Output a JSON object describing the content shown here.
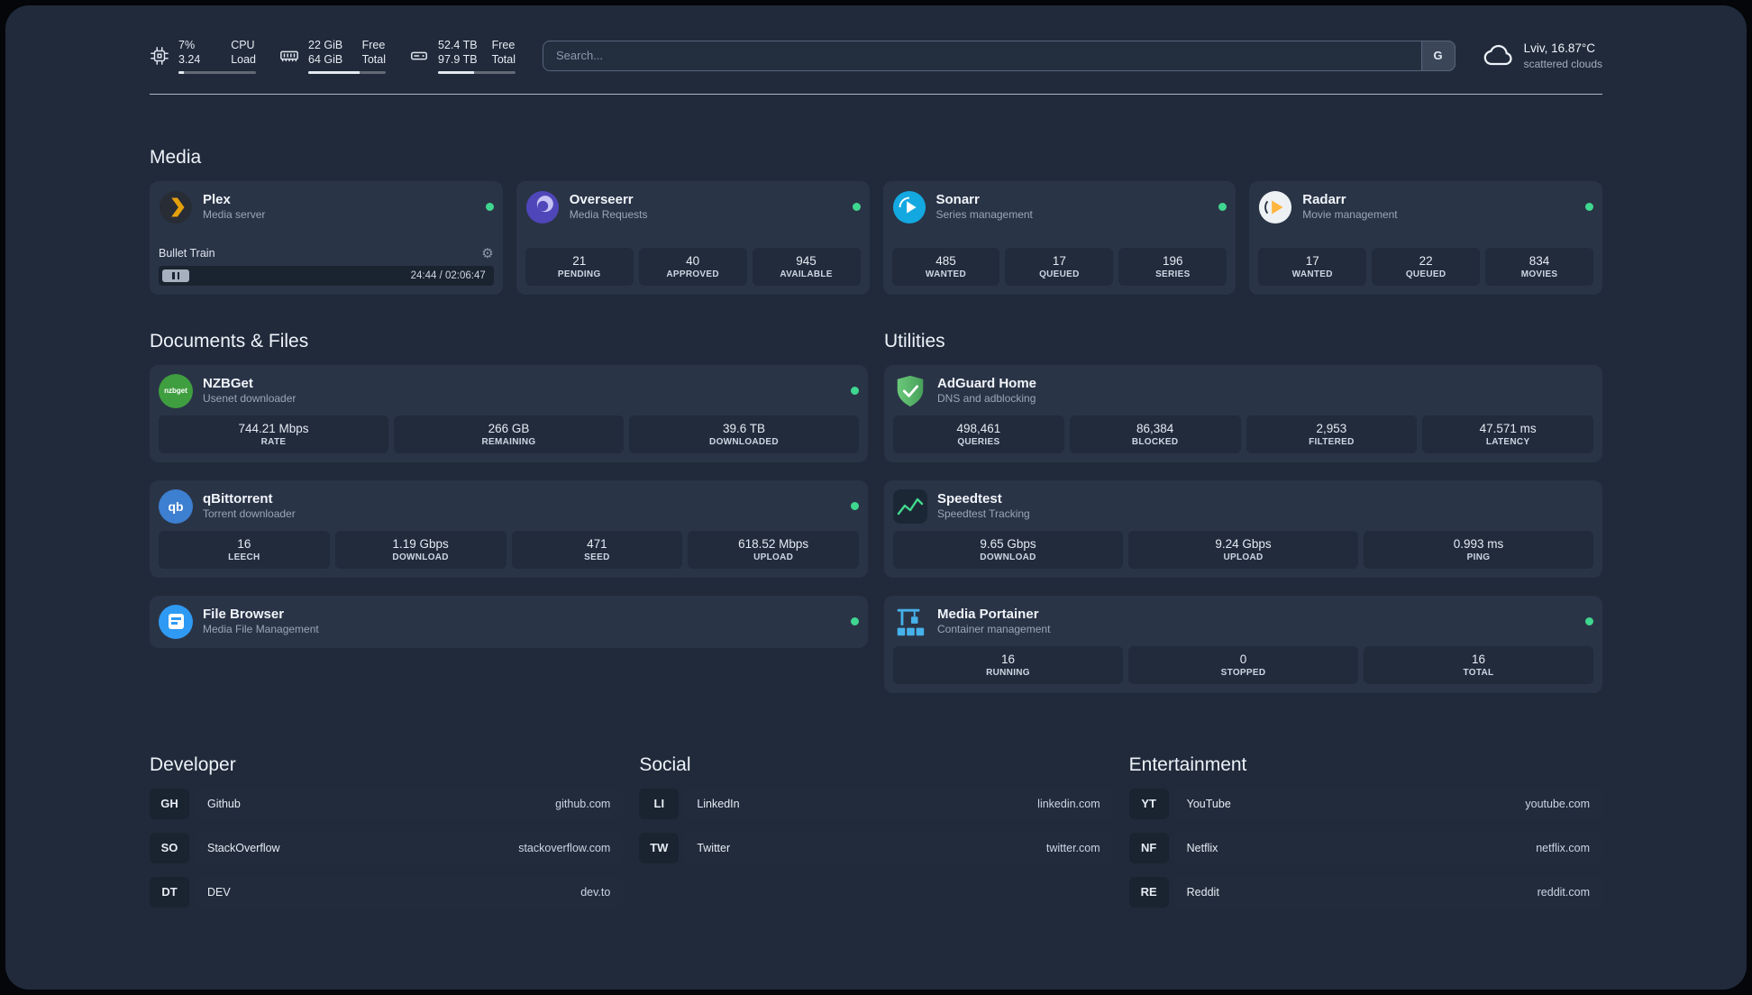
{
  "topbar": {
    "cpu": {
      "value1": "7%",
      "value2": "3.24",
      "label1": "CPU",
      "label2": "Load",
      "fill_percent": 7
    },
    "memory": {
      "value1": "22 GiB",
      "value2": "64 GiB",
      "label1": "Free",
      "label2": "Total",
      "fill_percent": 66
    },
    "disk": {
      "value1": "52.4 TB",
      "value2": "97.9 TB",
      "label1": "Free",
      "label2": "Total",
      "fill_percent": 47
    },
    "search": {
      "placeholder": "Search...",
      "engine_label": "G"
    },
    "weather": {
      "location": "Lviv, 16.87°C",
      "condition": "scattered clouds"
    }
  },
  "sections": {
    "media": {
      "title": "Media",
      "cards": [
        {
          "name": "Plex",
          "subtitle": "Media server",
          "status": "online",
          "player": {
            "track": "Bullet Train",
            "time": "24:44 / 02:06:47"
          }
        },
        {
          "name": "Overseerr",
          "subtitle": "Media Requests",
          "status": "online",
          "stats": [
            {
              "value": "21",
              "label": "PENDING"
            },
            {
              "value": "40",
              "label": "APPROVED"
            },
            {
              "value": "945",
              "label": "AVAILABLE"
            }
          ]
        },
        {
          "name": "Sonarr",
          "subtitle": "Series management",
          "status": "online",
          "stats": [
            {
              "value": "485",
              "label": "WANTED"
            },
            {
              "value": "17",
              "label": "QUEUED"
            },
            {
              "value": "196",
              "label": "SERIES"
            }
          ]
        },
        {
          "name": "Radarr",
          "subtitle": "Movie management",
          "status": "online",
          "stats": [
            {
              "value": "17",
              "label": "WANTED"
            },
            {
              "value": "22",
              "label": "QUEUED"
            },
            {
              "value": "834",
              "label": "MOVIES"
            }
          ]
        }
      ]
    },
    "documents": {
      "title": "Documents & Files",
      "cards": [
        {
          "name": "NZBGet",
          "subtitle": "Usenet downloader",
          "status": "online",
          "icon_text": "nzbget",
          "stats": [
            {
              "value": "744.21 Mbps",
              "label": "RATE"
            },
            {
              "value": "266 GB",
              "label": "REMAINING"
            },
            {
              "value": "39.6 TB",
              "label": "DOWNLOADED"
            }
          ]
        },
        {
          "name": "qBittorrent",
          "subtitle": "Torrent downloader",
          "status": "online",
          "icon_text": "qb",
          "stats": [
            {
              "value": "16",
              "label": "LEECH"
            },
            {
              "value": "1.19 Gbps",
              "label": "DOWNLOAD"
            },
            {
              "value": "471",
              "label": "SEED"
            },
            {
              "value": "618.52 Mbps",
              "label": "UPLOAD"
            }
          ]
        },
        {
          "name": "File Browser",
          "subtitle": "Media File Management",
          "status": "online"
        }
      ]
    },
    "utilities": {
      "title": "Utilities",
      "cards": [
        {
          "name": "AdGuard Home",
          "subtitle": "DNS and adblocking",
          "stats": [
            {
              "value": "498,461",
              "label": "QUERIES"
            },
            {
              "value": "86,384",
              "label": "BLOCKED"
            },
            {
              "value": "2,953",
              "label": "FILTERED"
            },
            {
              "value": "47.571 ms",
              "label": "LATENCY"
            }
          ]
        },
        {
          "name": "Speedtest",
          "subtitle": "Speedtest Tracking",
          "stats": [
            {
              "value": "9.65 Gbps",
              "label": "DOWNLOAD"
            },
            {
              "value": "9.24 Gbps",
              "label": "UPLOAD"
            },
            {
              "value": "0.993 ms",
              "label": "PING"
            }
          ]
        },
        {
          "name": "Media Portainer",
          "subtitle": "Container management",
          "status": "online",
          "stats": [
            {
              "value": "16",
              "label": "RUNNING"
            },
            {
              "value": "0",
              "label": "STOPPED"
            },
            {
              "value": "16",
              "label": "TOTAL"
            }
          ]
        }
      ]
    },
    "bookmarks": [
      {
        "title": "Developer",
        "items": [
          {
            "abbr": "GH",
            "name": "Github",
            "domain": "github.com"
          },
          {
            "abbr": "SO",
            "name": "StackOverflow",
            "domain": "stackoverflow.com"
          },
          {
            "abbr": "DT",
            "name": "DEV",
            "domain": "dev.to"
          }
        ]
      },
      {
        "title": "Social",
        "items": [
          {
            "abbr": "LI",
            "name": "LinkedIn",
            "domain": "linkedin.com"
          },
          {
            "abbr": "TW",
            "name": "Twitter",
            "domain": "twitter.com"
          }
        ]
      },
      {
        "title": "Entertainment",
        "items": [
          {
            "abbr": "YT",
            "name": "YouTube",
            "domain": "youtube.com"
          },
          {
            "abbr": "NF",
            "name": "Netflix",
            "domain": "netflix.com"
          },
          {
            "abbr": "RE",
            "name": "Reddit",
            "domain": "reddit.com"
          }
        ]
      }
    ]
  },
  "colors": {
    "status_online": "#3fd68f",
    "plex_amber": "#e5a00d",
    "overseerr_purple": "#4f46ba",
    "sonarr_blue": "#13a8e0",
    "radarr_orange": "#ffb53e",
    "nzbget_green": "#3f9e3f",
    "qbittorrent_blue": "#3d7fd0",
    "adguard_green": "#57b966",
    "speedtest_green": "#41d98c",
    "filebrowser_blue": "#2f9af3",
    "portainer_blue": "#46b1ea"
  }
}
